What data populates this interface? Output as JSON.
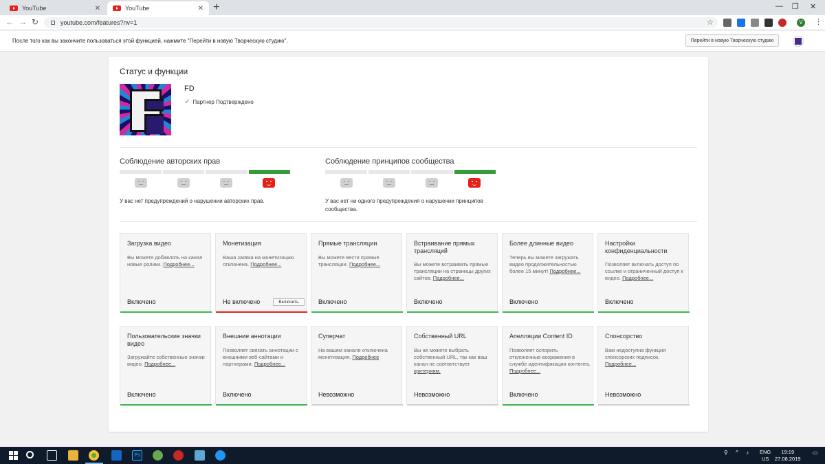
{
  "browser": {
    "tabs": [
      {
        "title": "YouTube",
        "active": false
      },
      {
        "title": "YouTube",
        "active": true
      }
    ],
    "url": "youtube.com/features?nv=1",
    "colors": {
      "youtube_red": "#e62117",
      "chrome_bg": "#dee1e6"
    }
  },
  "notice": {
    "text": "После того как вы закончите пользоваться этой функцией, нажмите \"Перейти в новую Творческую студию\".",
    "button_label": "Перейти в новую Творческую студию"
  },
  "status": {
    "title": "Статус и функции",
    "channel_name": "FD",
    "partner_label": "Партнер Подтверждено"
  },
  "strikes": {
    "copyright": {
      "title": "Соблюдение авторских прав",
      "text": "У вас нет предупреждений о нарушении авторских прав.",
      "active_index": 3
    },
    "community": {
      "title": "Соблюдение принципов сообщества",
      "text": "У вас нет ни одного предупреждения о нарушении принципов сообщества.",
      "active_index": 3
    },
    "colors": {
      "ok": "#3a9b3a",
      "strike_face": "#e62117"
    }
  },
  "features": [
    {
      "title": "Загрузка видео",
      "desc": "Вы можете добавлять на канал новые ролики.",
      "more": "Подробнее...",
      "status": "Включено",
      "state": "on"
    },
    {
      "title": "Монетизация",
      "desc": "Ваша заявка на монетизацию отклонена.",
      "more": "Подробнее...",
      "status": "Не включено",
      "state": "off",
      "button": "Включить"
    },
    {
      "title": "Прямые трансляции",
      "desc": "Вы можете вести прямые трансляции.",
      "more": "Подробнее...",
      "status": "Включено",
      "state": "on"
    },
    {
      "title": "Встраивание прямых трансляций",
      "desc": "Вы можете встраивать прямые трансляции на страницы других сайтов.",
      "more": "Подробнее...",
      "status": "Включено",
      "state": "on"
    },
    {
      "title": "Более длинные видео",
      "desc": "Теперь вы можете загружать видео продолжительностью более 15 минут!",
      "more": "Подробнее...",
      "status": "Включено",
      "state": "on"
    },
    {
      "title": "Настройки конфиденциальности",
      "desc": "Позволяет включать доступ по ссылке и ограниченный доступ к видео.",
      "more": "Подробнее...",
      "status": "Включено",
      "state": "on"
    },
    {
      "title": "Пользовательские значки видео",
      "desc": "Загружайте собственные значки видео.",
      "more": "Подробнее...",
      "status": "Включено",
      "state": "on"
    },
    {
      "title": "Внешние аннотации",
      "desc": "Позволяет связать аннотации с внешними веб-сайтами и партнерами.",
      "more": "Подробнее...",
      "status": "Включено",
      "state": "on"
    },
    {
      "title": "Суперчат",
      "desc": "На вашем канале отключена монетизация.",
      "more": "Подробнее",
      "status": "Невозможно",
      "state": "na"
    },
    {
      "title": "Собственный URL",
      "desc": "Вы не можете выбрать собственный URL, так как ваш канал не соответствует",
      "more": "критериям.",
      "status": "Невозможно",
      "state": "na"
    },
    {
      "title": "Апелляции Content ID",
      "desc": "Позволяет оспорить отклоненные возражения в службе идентификации контента.",
      "more": "Подробнее...",
      "status": "Включено",
      "state": "on"
    },
    {
      "title": "Спонсорство",
      "desc": "Вам недоступна функция спонсорских подписок.",
      "more": "Подробнее...",
      "status": "Невозможно",
      "state": "na"
    }
  ],
  "taskbar": {
    "lang_top": "ENG",
    "lang_bottom": "US",
    "time": "19:19",
    "date": "27.08.2019"
  }
}
